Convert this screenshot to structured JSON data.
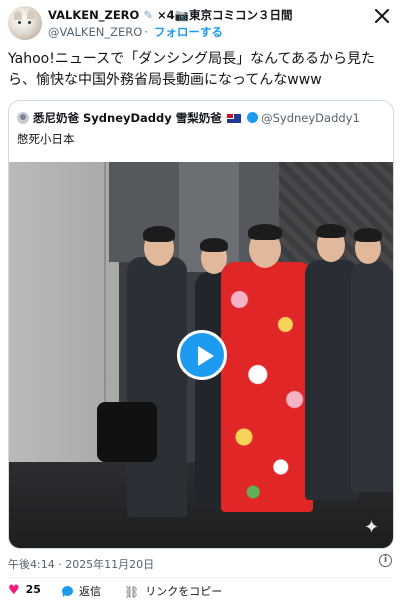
{
  "author": {
    "name": "VALKEN_ZERO",
    "name_extra": "×4",
    "name_suffix": "東京コミコン３日間",
    "handle": "@VALKEN_ZERO",
    "separator": "·",
    "follow_label": "フォローする"
  },
  "tweet": {
    "text": "Yahoo!ニュースで「ダンシング局長」なんてあるから見たら、愉快な中国外務省局長動画になってんなwww"
  },
  "quote": {
    "name": "悉尼奶爸 SydneyDaddy 雪梨奶爸",
    "handle": "@SydneyDaddy1",
    "text": "憋死小日本"
  },
  "video": {
    "play_icon": "play-icon",
    "sparkle_icon": "sparkle-icon"
  },
  "meta": {
    "timestamp": "午後4:14 · 2025年11月20日"
  },
  "actions": {
    "like_count": "25",
    "reply_label": "返信",
    "copy_link_label": "リンクをコピー"
  },
  "colors": {
    "accent": "#1d9bf0",
    "like": "#f91880"
  }
}
